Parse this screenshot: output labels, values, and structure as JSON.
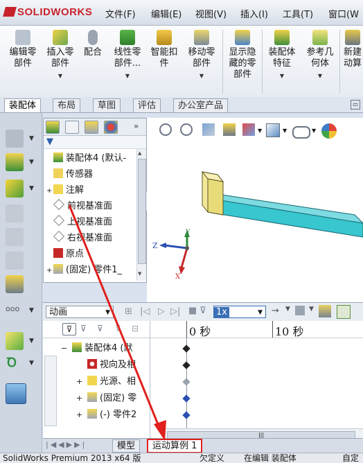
{
  "app": {
    "logo": "SOLIDWORKS"
  },
  "menu": [
    "文件(F)",
    "编辑(E)",
    "视图(V)",
    "插入(I)",
    "工具(T)",
    "窗口(W"
  ],
  "ribbon": [
    {
      "label": "编辑零部件",
      "lines": [
        "编辑零",
        "部件"
      ],
      "icon": "edit-component-icon"
    },
    {
      "label": "插入零部件",
      "lines": [
        "插入零",
        "部件"
      ],
      "icon": "insert-component-icon"
    },
    {
      "label": "配合",
      "lines": [
        "配合"
      ],
      "icon": "mate-icon"
    },
    {
      "label": "线性零部件...",
      "lines": [
        "线性零",
        "部件..."
      ],
      "icon": "linear-pattern-icon"
    },
    {
      "label": "智能扣件",
      "lines": [
        "智能扣",
        "件"
      ],
      "icon": "smart-fastener-icon"
    },
    {
      "label": "移动零部件",
      "lines": [
        "移动零",
        "部件"
      ],
      "icon": "move-component-icon"
    },
    {
      "label": "显示隐藏的零部件",
      "lines": [
        "显示隐",
        "藏的零",
        "部件"
      ],
      "icon": "show-hidden-icon"
    },
    {
      "label": "装配体特征",
      "lines": [
        "装配体",
        "特征"
      ],
      "icon": "assembly-feature-icon"
    },
    {
      "label": "参考几何体",
      "lines": [
        "参考几",
        "何体"
      ],
      "icon": "reference-geometry-icon"
    },
    {
      "label": "新建运动算例",
      "lines": [
        "新建",
        "动算"
      ],
      "icon": "new-motion-study-icon"
    }
  ],
  "tabs": [
    "装配体",
    "布局",
    "草图",
    "评估",
    "办公室产品"
  ],
  "feature_tree": {
    "filter_icon": "filter-icon",
    "items": [
      {
        "label": "装配体4 (默认-",
        "icon": "assembly-icon",
        "expander": ""
      },
      {
        "label": "传感器",
        "icon": "sensor-icon",
        "expander": ""
      },
      {
        "label": "注解",
        "icon": "annotation-icon",
        "expander": "+"
      },
      {
        "label": "前视基准面",
        "icon": "plane-icon",
        "expander": ""
      },
      {
        "label": "上视基准面",
        "icon": "plane-icon",
        "expander": ""
      },
      {
        "label": "右视基准面",
        "icon": "plane-icon",
        "expander": ""
      },
      {
        "label": "原点",
        "icon": "origin-icon",
        "expander": ""
      },
      {
        "label": "(固定) 零件1_",
        "icon": "part-icon",
        "expander": "+"
      }
    ]
  },
  "viewport": {
    "triad": {
      "x": "X",
      "y": "Y",
      "z": "Z"
    }
  },
  "motion_study": {
    "study_type": "动画",
    "speed": "1x",
    "time_labels": [
      "0 秒",
      "10 秒"
    ],
    "tree": [
      {
        "label": "装配体4 (默",
        "expander": "−"
      },
      {
        "label": "视向及相",
        "expander": ""
      },
      {
        "label": "光源、相",
        "expander": "+"
      },
      {
        "label": "(固定) 零",
        "expander": "+"
      },
      {
        "label": "(-) 零件2",
        "expander": "+"
      }
    ]
  },
  "bottom_tabs": [
    "模型",
    "运动算例 1"
  ],
  "status": {
    "text": "SolidWorks Premium 2013 x64 版",
    "fields": [
      "欠定义",
      "在编辑 装配体",
      "自定"
    ]
  },
  "colors": {
    "accent_red": "#c8232c",
    "highlight_red": "#e0201c",
    "part_cyan": "#38c6cf",
    "part_yellow": "#e8dc7a",
    "timeline_blue": "#2a4fb0"
  }
}
